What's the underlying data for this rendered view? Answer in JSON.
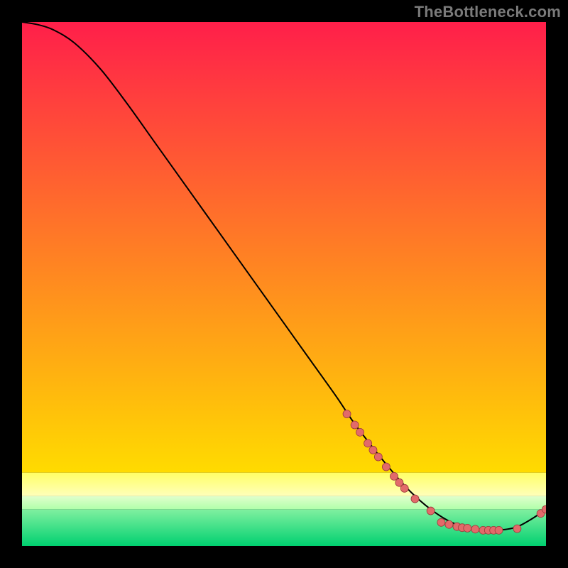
{
  "watermark": "TheBottleneck.com",
  "colors": {
    "bg_black": "#000000",
    "grad_top": "#ff1f4a",
    "grad_mid": "#ffdb00",
    "grad_bottom": "#00e27a",
    "curve": "#000000",
    "marker_fill": "#e26a6a",
    "marker_stroke": "#9c3b3b",
    "watermark": "#7a7a7a"
  },
  "chart_data": {
    "type": "line",
    "title": "",
    "xlabel": "",
    "ylabel": "",
    "xlim": [
      0,
      100
    ],
    "ylim": [
      0,
      100
    ],
    "series": [
      {
        "name": "bottleneck-curve",
        "x": [
          0,
          3,
          6,
          10,
          15,
          20,
          25,
          30,
          35,
          40,
          45,
          50,
          55,
          60,
          63,
          66,
          70,
          74,
          78,
          82,
          86,
          90,
          94,
          97,
          100
        ],
        "y": [
          100,
          99.5,
          98.5,
          96,
          91,
          84.5,
          77.5,
          70.5,
          63.5,
          56.5,
          49.5,
          42.5,
          35.5,
          28.5,
          24,
          20,
          15,
          10.5,
          7,
          4.5,
          3.3,
          3,
          3.5,
          5,
          7
        ]
      }
    ],
    "markers": [
      {
        "x": 62,
        "y": 25.2
      },
      {
        "x": 63.5,
        "y": 23.1
      },
      {
        "x": 64.5,
        "y": 21.7
      },
      {
        "x": 66,
        "y": 19.6
      },
      {
        "x": 67,
        "y": 18.3
      },
      {
        "x": 68,
        "y": 17.0
      },
      {
        "x": 69.5,
        "y": 15.1
      },
      {
        "x": 71,
        "y": 13.3
      },
      {
        "x": 72,
        "y": 12.1
      },
      {
        "x": 73,
        "y": 11.0
      },
      {
        "x": 75,
        "y": 9.0
      },
      {
        "x": 78,
        "y": 6.7
      },
      {
        "x": 80,
        "y": 4.5
      },
      {
        "x": 81.5,
        "y": 4.1
      },
      {
        "x": 83,
        "y": 3.7
      },
      {
        "x": 84,
        "y": 3.5
      },
      {
        "x": 85,
        "y": 3.4
      },
      {
        "x": 86.5,
        "y": 3.2
      },
      {
        "x": 88,
        "y": 3.0
      },
      {
        "x": 89,
        "y": 3.0
      },
      {
        "x": 90,
        "y": 3.0
      },
      {
        "x": 91,
        "y": 3.0
      },
      {
        "x": 94.5,
        "y": 3.3
      },
      {
        "x": 99,
        "y": 6.2
      },
      {
        "x": 100,
        "y": 7.0
      }
    ],
    "gradient_bands": [
      {
        "y0": 100,
        "y1": 14,
        "from": "#ff1f4a",
        "to": "#ffdb00",
        "comment": "red→yellow main span"
      },
      {
        "y0": 14,
        "y1": 9.5,
        "from": "#ffff66",
        "to": "#ffffbb",
        "comment": "pale yellow band"
      },
      {
        "y0": 9.5,
        "y1": 7.0,
        "from": "#e0ffcc",
        "to": "#b0ffaa",
        "comment": "yellow-green transition"
      },
      {
        "y0": 7.0,
        "y1": 0,
        "from": "#80f0a0",
        "to": "#00d070",
        "comment": "green base"
      }
    ]
  }
}
